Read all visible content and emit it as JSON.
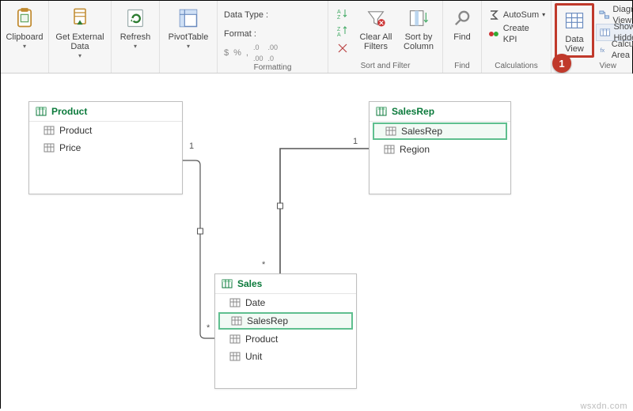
{
  "ribbon": {
    "clipboard": {
      "label": "Clipboard",
      "group": ""
    },
    "getdata": {
      "label": "Get External\nData",
      "group": ""
    },
    "refresh": {
      "label": "Refresh",
      "group": ""
    },
    "pivot": {
      "label": "PivotTable",
      "group": ""
    },
    "formatting": {
      "group": "Formatting",
      "datatype_label": "Data Type :",
      "format_label": "Format :"
    },
    "sortfilter": {
      "group": "Sort and Filter",
      "clearall": "Clear All\nFilters",
      "sortby": "Sort by\nColumn"
    },
    "find": {
      "label": "Find",
      "group": "Find"
    },
    "calculations": {
      "group": "Calculations",
      "autosum": "AutoSum",
      "createkpi": "Create KPI"
    },
    "view": {
      "group": "View",
      "dataview": "Data\nView",
      "diagramview": "Diagram View",
      "showhidden": "Show Hidden",
      "calcarea": "Calculation Area"
    }
  },
  "callout": {
    "num": "1"
  },
  "diagram": {
    "product": {
      "title": "Product",
      "fields": [
        "Product",
        "Price"
      ]
    },
    "salesrep": {
      "title": "SalesRep",
      "fields": [
        "SalesRep",
        "Region"
      ],
      "selected": 0
    },
    "sales": {
      "title": "Sales",
      "fields": [
        "Date",
        "SalesRep",
        "Product",
        "Unit"
      ],
      "selected": 1
    },
    "cardinality": {
      "one": "1",
      "many": "*"
    }
  },
  "watermark": "wsxdn.com"
}
